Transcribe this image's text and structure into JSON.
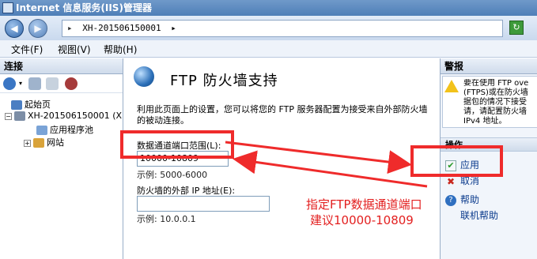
{
  "window": {
    "title": "Internet 信息服务(IIS)管理器"
  },
  "address": {
    "separator": "▸",
    "host": "XH-201506150001",
    "tail": "▸"
  },
  "menu": [
    "文件(F)",
    "视图(V)",
    "帮助(H)"
  ],
  "left_panel": {
    "header": "连接",
    "tree": [
      {
        "label": "起始页"
      },
      {
        "label": "XH-201506150001 (X"
      },
      {
        "label": "应用程序池"
      },
      {
        "label": "网站"
      }
    ]
  },
  "main": {
    "title": "FTP 防火墙支持",
    "description": "利用此页面上的设置，您可以将您的 FTP 服务器配置为接受来自外部防火墙的被动连接。",
    "port_range_label": "数据通道端口范围(L):",
    "port_range_value": "10000-10809",
    "port_range_hint": "示例: 5000-6000",
    "external_ip_label": "防火墙的外部 IP 地址(E):",
    "external_ip_value": "",
    "external_ip_hint": "示例: 10.0.0.1"
  },
  "right_panel": {
    "alerts_header": "警报",
    "alert_lines": [
      "要在使用 FTP ove",
      "(FTPS)或在防火墙",
      "据包的情况下接受",
      "请，请配置防火墙",
      "IPv4 地址。"
    ],
    "actions_header": "操作",
    "actions": [
      {
        "label": "应用",
        "icon": "apply-check-icon"
      },
      {
        "label": "取消",
        "icon": "cancel-x-icon"
      },
      {
        "label": "帮助",
        "icon": "help-icon"
      },
      {
        "label": "联机帮助",
        "icon": ""
      }
    ]
  },
  "annotation": {
    "line1": "指定FTP数据通道端口",
    "line2": "建议10000-10809"
  },
  "colors": {
    "annotation_red": "#ef2b2b",
    "titlebar": "#4f7fb8",
    "link": "#0a3a8c"
  }
}
